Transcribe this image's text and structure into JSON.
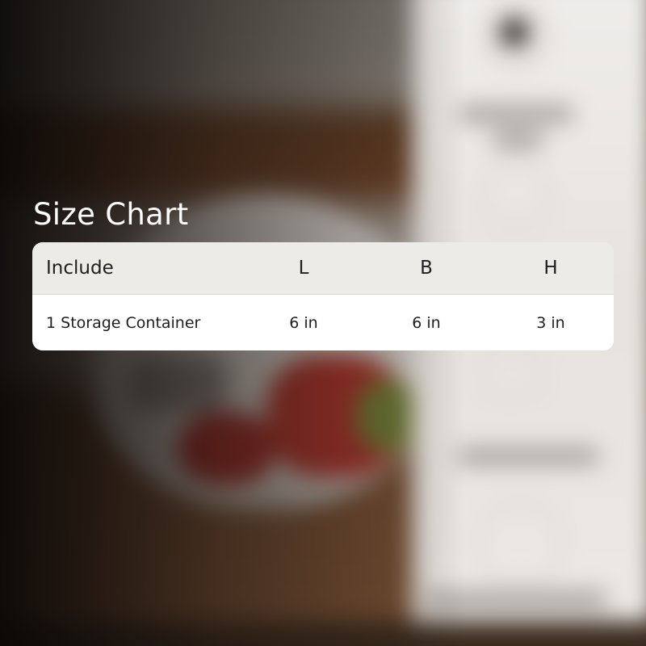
{
  "size_chart": {
    "title": "Size Chart",
    "columns": [
      "Include",
      "L",
      "B",
      "H"
    ],
    "rows": [
      {
        "include": "1 Storage Container",
        "l": "6 in",
        "b": "6 in",
        "h": "3 in"
      }
    ]
  },
  "colors": {
    "header_background": "#edebe7",
    "row_background": "#ffffff",
    "title_text": "#ffffff",
    "cell_text": "#1e1e1e"
  }
}
